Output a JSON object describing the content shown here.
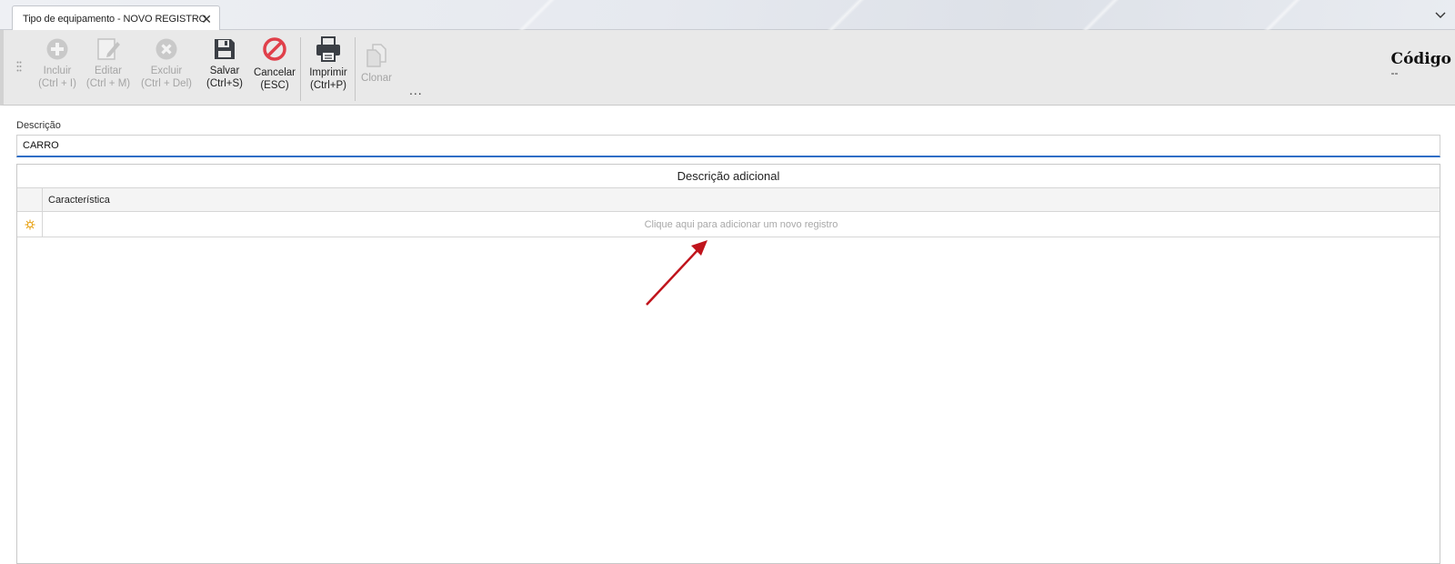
{
  "tab": {
    "title": "Tipo de equipamento - NOVO REGISTRO",
    "close_glyph": "✕"
  },
  "toolbar": {
    "buttons": [
      {
        "id": "incluir",
        "label": "Incluir",
        "shortcut": "(Ctrl + I)",
        "icon": "plus-circle-icon",
        "enabled": false
      },
      {
        "id": "editar",
        "label": "Editar",
        "shortcut": "(Ctrl + M)",
        "icon": "edit-icon",
        "enabled": false
      },
      {
        "id": "excluir",
        "label": "Excluir",
        "shortcut": "(Ctrl + Del)",
        "icon": "delete-circle-icon",
        "enabled": false
      },
      {
        "id": "salvar",
        "label": "Salvar",
        "shortcut": "(Ctrl+S)",
        "icon": "save-icon",
        "enabled": true
      },
      {
        "id": "cancelar",
        "label": "Cancelar",
        "shortcut": "(ESC)",
        "icon": "cancel-icon",
        "enabled": true
      },
      {
        "id": "imprimir",
        "label": "Imprimir",
        "shortcut": "(Ctrl+P)",
        "icon": "printer-icon",
        "enabled": true
      },
      {
        "id": "clonar",
        "label": "Clonar",
        "shortcut": "",
        "icon": "clone-icon",
        "enabled": false
      }
    ],
    "more": "..."
  },
  "codigo": {
    "label": "Código",
    "value": "--"
  },
  "form": {
    "descricao_label": "Descrição",
    "descricao_value": "CARRO"
  },
  "grid": {
    "caption": "Descrição adicional",
    "columns": [
      "Característica"
    ],
    "new_row_hint": "Clique aqui para adicionar um novo registro"
  },
  "colors": {
    "accent": "#2f6ec6",
    "cancel": "#e0404a",
    "annotation_arrow": "#c0141c",
    "new_row_icon": "#e8a317"
  }
}
